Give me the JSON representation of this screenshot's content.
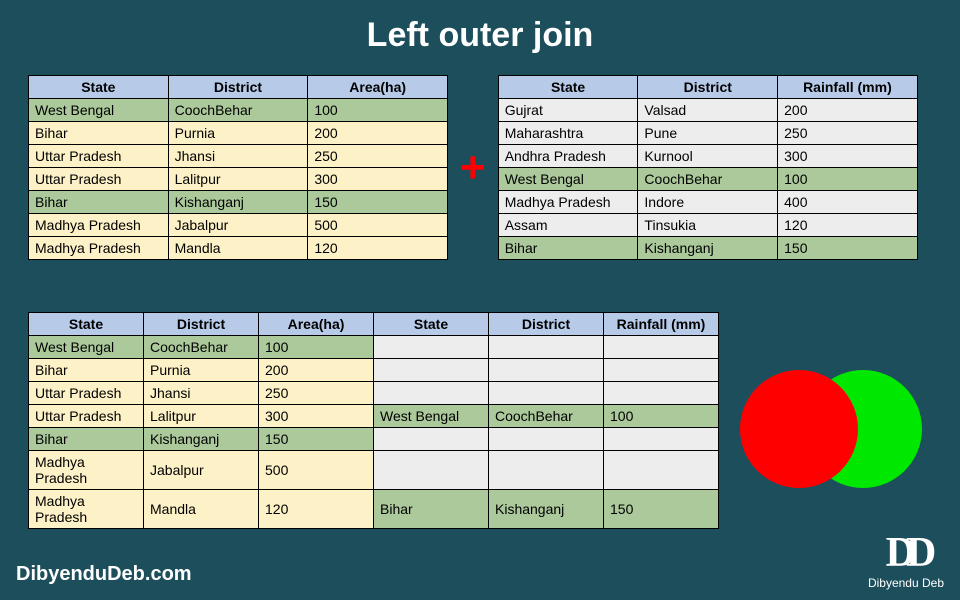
{
  "title": "Left outer join",
  "plus": "+",
  "left_table": {
    "headers": [
      "State",
      "District",
      "Area(ha)"
    ],
    "rows": [
      {
        "cls": "row-green",
        "cells": [
          "West Bengal",
          "CoochBehar",
          "100"
        ]
      },
      {
        "cls": "row-beige",
        "cells": [
          "Bihar",
          "Purnia",
          "200"
        ]
      },
      {
        "cls": "row-beige",
        "cells": [
          "Uttar Pradesh",
          "Jhansi",
          "250"
        ]
      },
      {
        "cls": "row-beige",
        "cells": [
          "Uttar Pradesh",
          "Lalitpur",
          "300"
        ]
      },
      {
        "cls": "row-green",
        "cells": [
          "Bihar",
          "Kishanganj",
          "150"
        ]
      },
      {
        "cls": "row-beige",
        "cells": [
          "Madhya Pradesh",
          "Jabalpur",
          "500"
        ]
      },
      {
        "cls": "row-beige",
        "cells": [
          "Madhya Pradesh",
          "Mandla",
          "120"
        ]
      }
    ]
  },
  "right_table": {
    "headers": [
      "State",
      "District",
      "Rainfall (mm)"
    ],
    "rows": [
      {
        "cls": "row-grey",
        "cells": [
          "Gujrat",
          "Valsad",
          "200"
        ]
      },
      {
        "cls": "row-grey",
        "cells": [
          "Maharashtra",
          "Pune",
          "250"
        ]
      },
      {
        "cls": "row-grey",
        "cells": [
          "Andhra Pradesh",
          "Kurnool",
          "300"
        ]
      },
      {
        "cls": "row-green",
        "cells": [
          "West Bengal",
          "CoochBehar",
          "100"
        ]
      },
      {
        "cls": "row-grey",
        "cells": [
          "Madhya Pradesh",
          "Indore",
          "400"
        ]
      },
      {
        "cls": "row-grey",
        "cells": [
          "Assam",
          "Tinsukia",
          "120"
        ]
      },
      {
        "cls": "row-green",
        "cells": [
          "Bihar",
          "Kishanganj",
          "150"
        ]
      }
    ]
  },
  "join_table": {
    "headers": [
      "State",
      "District",
      "Area(ha)",
      "State",
      "District",
      "Rainfall (mm)"
    ],
    "rows": [
      {
        "cells": [
          {
            "t": "West Bengal",
            "cls": "row-green"
          },
          {
            "t": "CoochBehar",
            "cls": "row-green"
          },
          {
            "t": "100",
            "cls": "row-green"
          },
          {
            "t": "",
            "cls": "row-grey"
          },
          {
            "t": "",
            "cls": "row-grey"
          },
          {
            "t": "",
            "cls": "row-grey"
          }
        ]
      },
      {
        "cells": [
          {
            "t": "Bihar",
            "cls": "row-beige"
          },
          {
            "t": "Purnia",
            "cls": "row-beige"
          },
          {
            "t": "200",
            "cls": "row-beige"
          },
          {
            "t": "",
            "cls": "row-grey"
          },
          {
            "t": "",
            "cls": "row-grey"
          },
          {
            "t": "",
            "cls": "row-grey"
          }
        ]
      },
      {
        "cells": [
          {
            "t": "Uttar Pradesh",
            "cls": "row-beige"
          },
          {
            "t": "Jhansi",
            "cls": "row-beige"
          },
          {
            "t": "250",
            "cls": "row-beige"
          },
          {
            "t": "",
            "cls": "row-grey"
          },
          {
            "t": "",
            "cls": "row-grey"
          },
          {
            "t": "",
            "cls": "row-grey"
          }
        ]
      },
      {
        "cells": [
          {
            "t": "Uttar Pradesh",
            "cls": "row-beige"
          },
          {
            "t": "Lalitpur",
            "cls": "row-beige"
          },
          {
            "t": "300",
            "cls": "row-beige"
          },
          {
            "t": "West Bengal",
            "cls": "row-green"
          },
          {
            "t": "CoochBehar",
            "cls": "row-green"
          },
          {
            "t": "100",
            "cls": "row-green"
          }
        ]
      },
      {
        "cells": [
          {
            "t": "Bihar",
            "cls": "row-green"
          },
          {
            "t": "Kishanganj",
            "cls": "row-green"
          },
          {
            "t": "150",
            "cls": "row-green"
          },
          {
            "t": "",
            "cls": "row-grey"
          },
          {
            "t": "",
            "cls": "row-grey"
          },
          {
            "t": "",
            "cls": "row-grey"
          }
        ]
      },
      {
        "cells": [
          {
            "t": "Madhya Pradesh",
            "cls": "row-beige"
          },
          {
            "t": "Jabalpur",
            "cls": "row-beige"
          },
          {
            "t": "500",
            "cls": "row-beige"
          },
          {
            "t": "",
            "cls": "row-grey"
          },
          {
            "t": "",
            "cls": "row-grey"
          },
          {
            "t": "",
            "cls": "row-grey"
          }
        ]
      },
      {
        "cells": [
          {
            "t": "Madhya Pradesh",
            "cls": "row-beige"
          },
          {
            "t": "Mandla",
            "cls": "row-beige"
          },
          {
            "t": "120",
            "cls": "row-beige"
          },
          {
            "t": "Bihar",
            "cls": "row-green"
          },
          {
            "t": "Kishanganj",
            "cls": "row-green"
          },
          {
            "t": "150",
            "cls": "row-green"
          }
        ]
      }
    ]
  },
  "footer": {
    "site": "DibyenduDeb.com",
    "logo": "DD",
    "name": "Dibyendu Deb"
  }
}
